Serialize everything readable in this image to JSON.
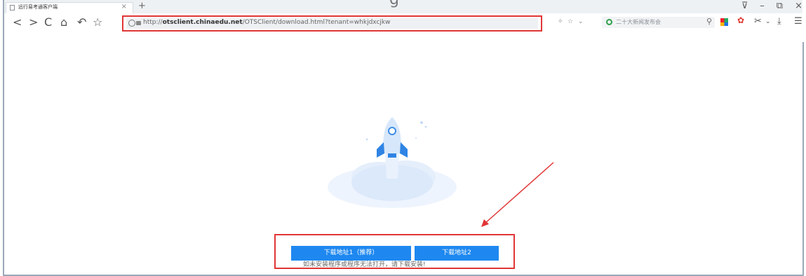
{
  "browser": {
    "tab_title": "远行易考通客户端",
    "tab_close": "×",
    "new_tab": "+",
    "top_ghost": "g",
    "win_controls": [
      "⊽",
      "–",
      "⧉",
      "×"
    ],
    "nav": {
      "back": "<",
      "forward": ">",
      "reload": "C",
      "home": "⌂",
      "undo": "↶",
      "favorite": "☆"
    },
    "url_prefix": "http://",
    "url_domain": "otsclient.chinaedu.net",
    "url_path": "/OTSClient/download.html?tenant=whkjdxcjkw",
    "toolbar_small": [
      "✧",
      "☆",
      "⌄"
    ],
    "search_text": "二十大新闻发布会",
    "search_icon": "search-icon",
    "right_icons": [
      "✂",
      "⌄",
      "⤓",
      "☰"
    ]
  },
  "page": {
    "install_message": "如未安装程序或程序无法打开，请下载安装!",
    "download_button_1": "下载地址1（推荐）",
    "download_button_2": "下载地址2"
  },
  "colors": {
    "accent_blue": "#1e88f0",
    "annotation_red": "#e03535",
    "rocket_light": "#dce9fb"
  }
}
